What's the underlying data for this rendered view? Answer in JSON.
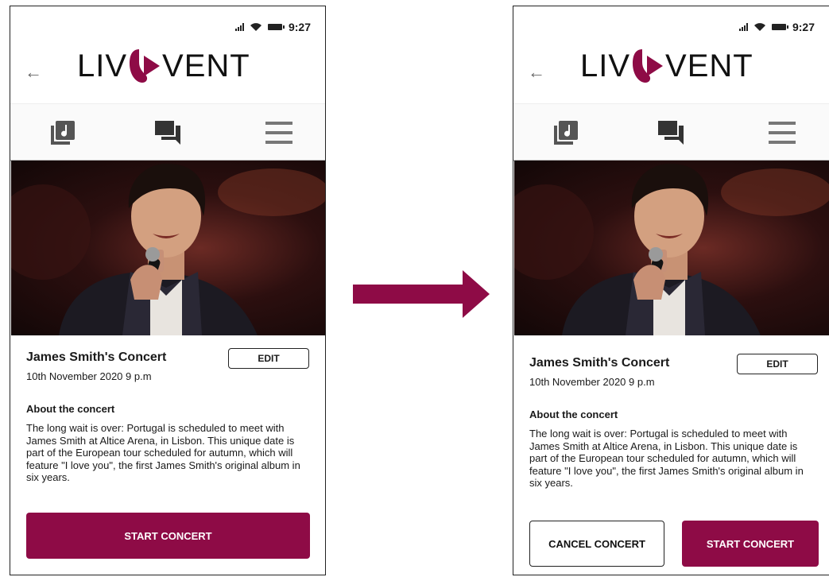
{
  "screens": [
    {
      "status": {
        "time": "9:27"
      },
      "logo": {
        "left": "LIV",
        "right": "VENT"
      },
      "event": {
        "title": "James Smith's Concert",
        "datetime": "10th November 2020  9 p.m",
        "edit_label": "EDIT",
        "about_heading": "About the concert",
        "about_text": "The long wait is over: Portugal is scheduled to meet with James Smith at Altice Arena, in Lisbon. This unique date is part of the European tour scheduled for autumn, which will feature \"I love you\", the first James Smith's original album in six years."
      },
      "buttons": {
        "start": "START CONCERT"
      }
    },
    {
      "status": {
        "time": "9:27"
      },
      "logo": {
        "left": "LIV",
        "right": "VENT"
      },
      "event": {
        "title": "James Smith's Concert",
        "datetime": "10th November 2020  9 p.m",
        "edit_label": "EDIT",
        "about_heading": "About the concert",
        "about_text": "The long wait is over: Portugal is scheduled to meet with James Smith at Altice Arena, in Lisbon. This unique date is part of the European tour scheduled for autumn, which will feature \"I love you\", the first James Smith's original album in six years."
      },
      "buttons": {
        "cancel": "CANCEL CONCERT",
        "start": "START CONCERT"
      }
    }
  ],
  "icons": [
    "back-arrow-icon",
    "music-library-icon",
    "chat-icon",
    "menu-icon",
    "signal-icon",
    "wifi-icon",
    "battery-icon",
    "transition-arrow-icon"
  ],
  "colors": {
    "brand": "#8e0b46"
  }
}
